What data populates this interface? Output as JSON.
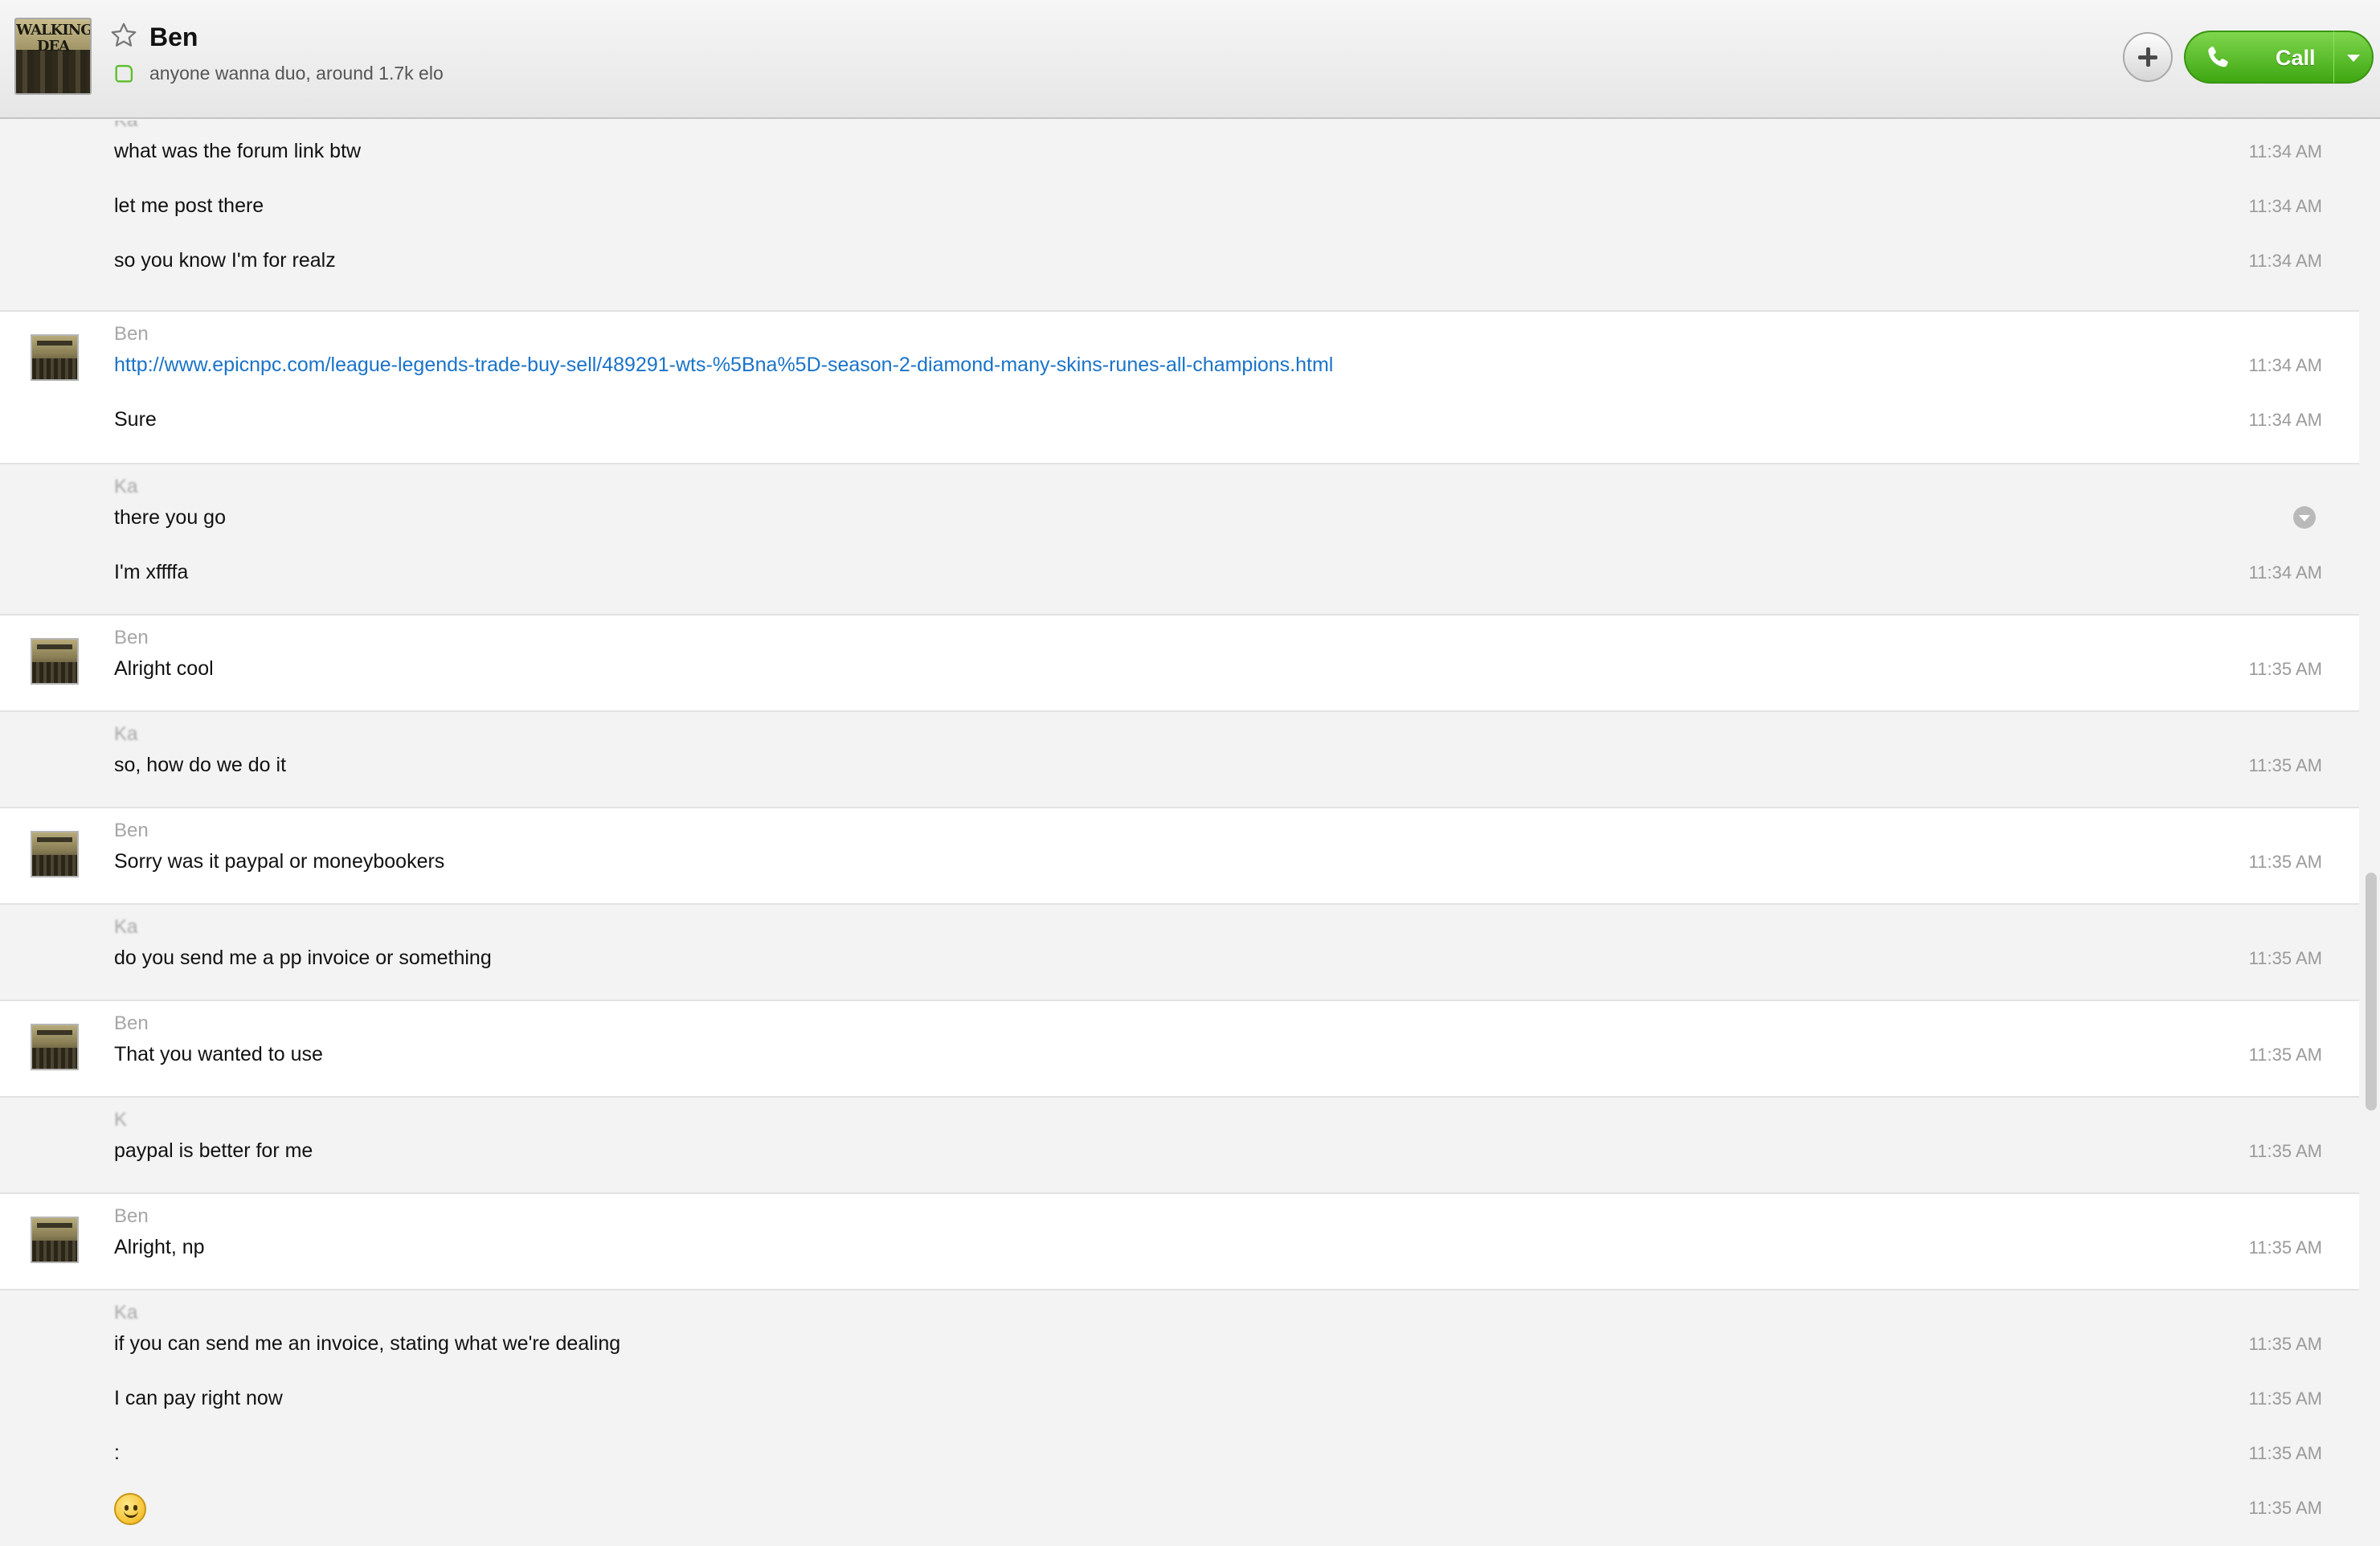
{
  "header": {
    "contact_name": "Ben",
    "mood_message": "anyone wanna duo, around 1.7k elo",
    "avatar_label": "WALKING DEA",
    "call_label": "Call"
  },
  "messages": [
    {
      "sender": "Ka",
      "side": "me",
      "lines": [
        {
          "text": "what was the forum link btw",
          "time": "11:34 AM"
        },
        {
          "text": "let me post there",
          "time": "11:34 AM"
        },
        {
          "text": "so you know I'm for realz",
          "time": "11:34 AM"
        }
      ]
    },
    {
      "sender": "Ben",
      "side": "them",
      "lines": [
        {
          "text": "http://www.epicnpc.com/league-legends-trade-buy-sell/489291-wts-%5Bna%5D-season-2-diamond-many-skins-runes-all-champions.html",
          "time": "11:34 AM",
          "link": true
        },
        {
          "text": "Sure",
          "time": "11:34 AM"
        }
      ]
    },
    {
      "sender": "Ka",
      "side": "me",
      "lines": [
        {
          "text": "there you go",
          "time": ""
        },
        {
          "text": "I'm xffffa",
          "time": "11:34 AM"
        }
      ]
    },
    {
      "sender": "Ben",
      "side": "them",
      "lines": [
        {
          "text": "Alright cool",
          "time": "11:35 AM"
        }
      ]
    },
    {
      "sender": "Ka",
      "side": "me",
      "lines": [
        {
          "text": "so, how do we do it",
          "time": "11:35 AM"
        }
      ]
    },
    {
      "sender": "Ben",
      "side": "them",
      "lines": [
        {
          "text": "Sorry was it paypal or moneybookers",
          "time": "11:35 AM"
        }
      ]
    },
    {
      "sender": "Ka",
      "side": "me",
      "lines": [
        {
          "text": "do you send me a pp invoice or something",
          "time": "11:35 AM"
        }
      ]
    },
    {
      "sender": "Ben",
      "side": "them",
      "lines": [
        {
          "text": "That you wanted to use",
          "time": "11:35 AM"
        }
      ]
    },
    {
      "sender": "K",
      "side": "me",
      "lines": [
        {
          "text": "paypal is better for me",
          "time": "11:35 AM"
        }
      ]
    },
    {
      "sender": "Ben",
      "side": "them",
      "lines": [
        {
          "text": "Alright, np",
          "time": "11:35 AM"
        }
      ]
    },
    {
      "sender": "Ka",
      "side": "me",
      "lines": [
        {
          "text": "if you can send me an invoice, stating what we're dealing",
          "time": "11:35 AM"
        },
        {
          "text": "I can pay right now",
          "time": "11:35 AM"
        },
        {
          "text": ":",
          "time": "11:35 AM"
        },
        {
          "text": "",
          "time": "11:35 AM",
          "emoji": "smiley-icon"
        }
      ]
    }
  ],
  "scrollbar": {
    "position_fraction": 0.62
  }
}
